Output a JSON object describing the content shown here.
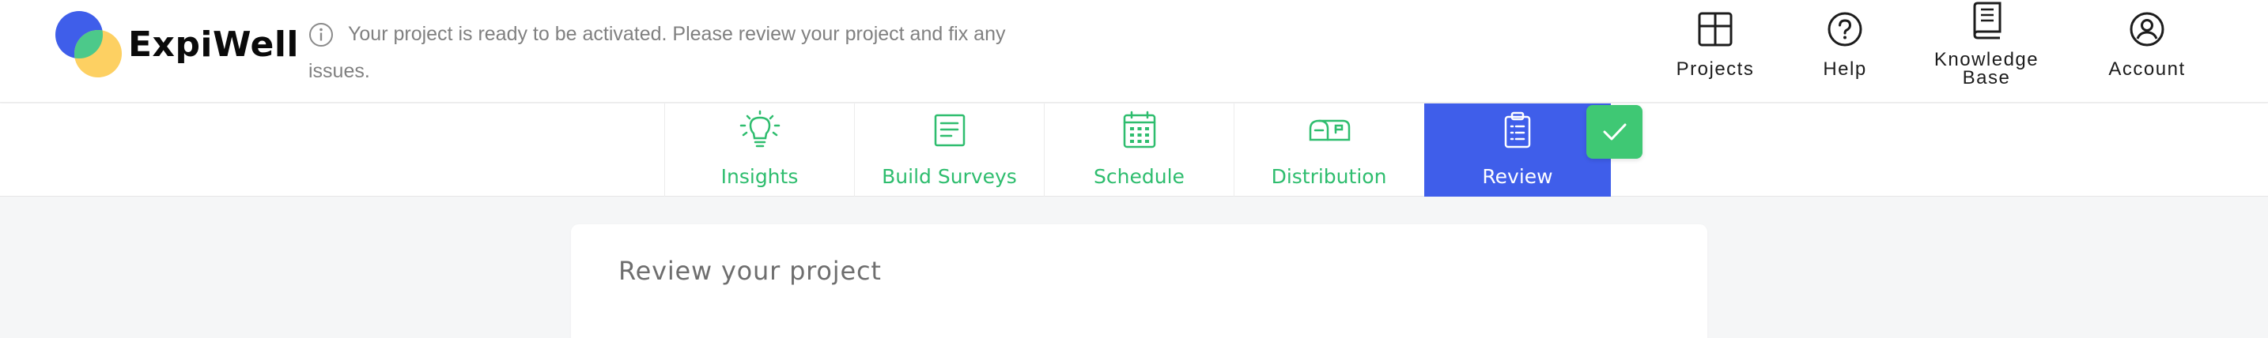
{
  "brand": {
    "name": "ExpiWell"
  },
  "notice": {
    "icon": "info-circle-icon",
    "line1": "Your project is ready to be activated. Please review your project and fix any",
    "line2": "issues."
  },
  "nav": {
    "items": [
      {
        "label": "Projects",
        "icon": "grid-icon"
      },
      {
        "label": "Help",
        "icon": "question-circle-icon"
      },
      {
        "label_line1": "Knowledge",
        "label_line2": "Base",
        "icon": "book-icon"
      },
      {
        "label": "Account",
        "icon": "user-circle-icon"
      }
    ]
  },
  "tabs": {
    "items": [
      {
        "label": "Insights",
        "icon": "lightbulb-icon"
      },
      {
        "label": "Build Surveys",
        "icon": "document-icon"
      },
      {
        "label": "Schedule",
        "icon": "calendar-icon"
      },
      {
        "label": "Distribution",
        "icon": "mailbox-icon"
      },
      {
        "label": "Review",
        "icon": "clipboard-icon",
        "active": true
      }
    ],
    "completed_icon": "checkmark-icon"
  },
  "main": {
    "card_title": "Review your project"
  },
  "colors": {
    "accent_blue": "#3f5eea",
    "accent_green": "#2ebd6e",
    "badge_green": "#3fc874",
    "logo_blue": "#3f5eea",
    "logo_yellow": "#fdd062",
    "logo_green": "#4cc98a"
  }
}
